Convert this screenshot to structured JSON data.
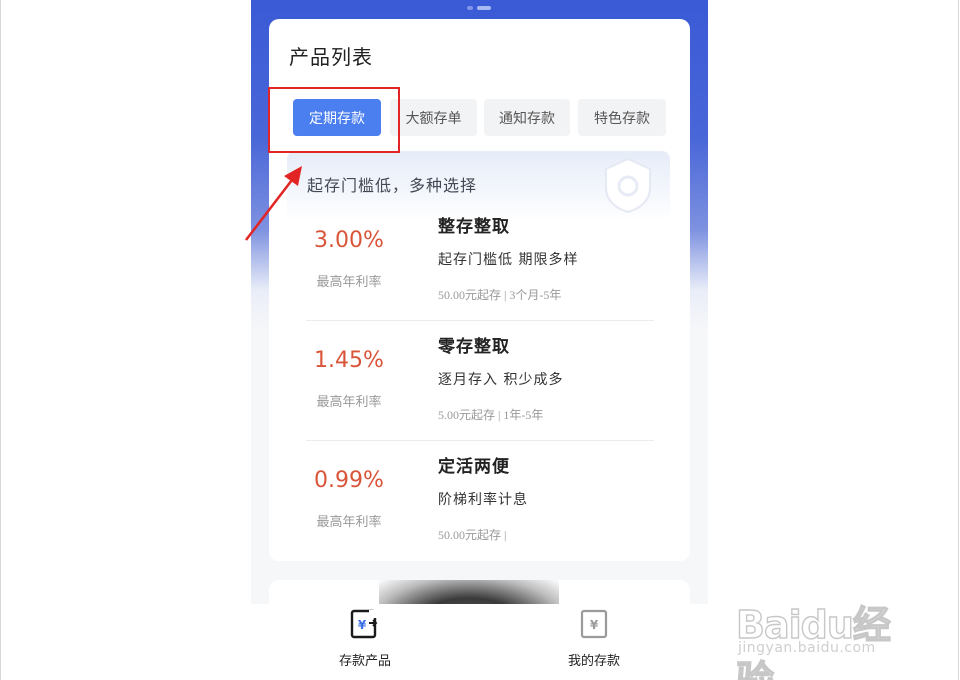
{
  "card": {
    "title": "产品列表",
    "tabs": [
      {
        "label": "定期存款",
        "active": true
      },
      {
        "label": "大额存单",
        "active": false
      },
      {
        "label": "通知存款",
        "active": false
      },
      {
        "label": "特色存款",
        "active": false
      }
    ],
    "banner": {
      "text": "起存门槛低，多种选择",
      "icon": "shield-icon"
    },
    "products": [
      {
        "rate": "3.00%",
        "rate_label": "最高年利率",
        "name": "整存整取",
        "desc": "起存门槛低  期限多样",
        "meta": "50.00元起存 | 3个月-5年"
      },
      {
        "rate": "1.45%",
        "rate_label": "最高年利率",
        "name": "零存整取",
        "desc": "逐月存入  积少成多",
        "meta": "5.00元起存 | 1年-5年"
      },
      {
        "rate": "0.99%",
        "rate_label": "最高年利率",
        "name": "定活两便",
        "desc": "阶梯利率计息",
        "meta": "50.00元起存 |"
      }
    ]
  },
  "bottom_nav": [
    {
      "label": "存款产品",
      "icon": "deposit-products-icon",
      "active": true
    },
    {
      "label": "我的存款",
      "icon": "my-deposits-icon",
      "active": false
    }
  ],
  "watermark": {
    "logo": "Baidu经验",
    "url": "jingyan.baidu.com"
  },
  "colors": {
    "accent": "#4b7ff0",
    "rate": "#d9553a",
    "header_blue": "#3a5ad6",
    "annotation_red": "#e32424"
  }
}
